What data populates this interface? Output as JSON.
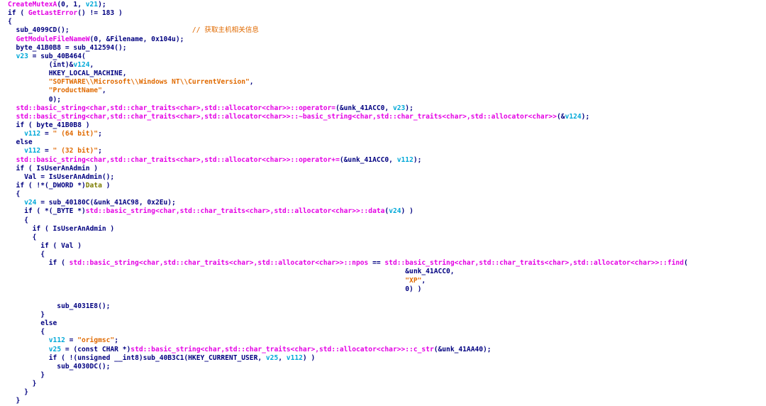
{
  "code": {
    "colors": {
      "p": "#000080",
      "f": "#e400e4",
      "v": "#00a8d8",
      "s": "#e06a00",
      "c": "#e06a00",
      "g": "#7c7c00",
      "k": "#000080"
    },
    "lines": [
      [
        [
          "f",
          "CreateMutexA"
        ],
        [
          "p",
          "(0, 1, "
        ],
        [
          "v",
          "v21"
        ],
        [
          "p",
          ");"
        ]
      ],
      [
        [
          "p",
          "if ( "
        ],
        [
          "f",
          "GetLastError"
        ],
        [
          "p",
          "() != 183 )"
        ]
      ],
      [
        [
          "p",
          "{"
        ]
      ],
      [
        [
          "p",
          "  sub_4099CD();                              "
        ],
        [
          "c",
          "// 获取主机相关信息"
        ]
      ],
      [
        [
          "p",
          "  "
        ],
        [
          "f",
          "GetModuleFileNameW"
        ],
        [
          "p",
          "(0, &Filename, 0x104u);"
        ]
      ],
      [
        [
          "p",
          "  byte_41B0B8 = sub_412594();"
        ]
      ],
      [
        [
          "p",
          "  "
        ],
        [
          "v",
          "v23"
        ],
        [
          "p",
          " = sub_40B464("
        ]
      ],
      [
        [
          "p",
          "          ("
        ],
        [
          "k",
          "int"
        ],
        [
          "p",
          ")&"
        ],
        [
          "v",
          "v124"
        ],
        [
          "p",
          ","
        ]
      ],
      [
        [
          "p",
          "          HKEY_LOCAL_MACHINE,"
        ]
      ],
      [
        [
          "p",
          "          "
        ],
        [
          "s",
          "\"SOFTWARE\\\\Microsoft\\\\Windows NT\\\\CurrentVersion\""
        ],
        [
          "p",
          ","
        ]
      ],
      [
        [
          "p",
          "          "
        ],
        [
          "s",
          "\"ProductName\""
        ],
        [
          "p",
          ","
        ]
      ],
      [
        [
          "p",
          "          0);"
        ]
      ],
      [
        [
          "p",
          "  "
        ],
        [
          "f",
          "std::basic_string<char,std::char_traits<char>,std::allocator<char>>::operator="
        ],
        [
          "p",
          "(&unk_41ACC0, "
        ],
        [
          "v",
          "v23"
        ],
        [
          "p",
          ");"
        ]
      ],
      [
        [
          "p",
          "  "
        ],
        [
          "f",
          "std::basic_string<char,std::char_traits<char>,std::allocator<char>>::~basic_string<char,std::char_traits<char>,std::allocator<char>>"
        ],
        [
          "p",
          "(&"
        ],
        [
          "v",
          "v124"
        ],
        [
          "p",
          ");"
        ]
      ],
      [
        [
          "p",
          "  if ( byte_41B0B8 )"
        ]
      ],
      [
        [
          "p",
          "    "
        ],
        [
          "v",
          "v112"
        ],
        [
          "p",
          " = "
        ],
        [
          "s",
          "\" (64 bit)\""
        ],
        [
          "p",
          ";"
        ]
      ],
      [
        [
          "p",
          "  else"
        ]
      ],
      [
        [
          "p",
          "    "
        ],
        [
          "v",
          "v112"
        ],
        [
          "p",
          " = "
        ],
        [
          "s",
          "\" (32 bit)\""
        ],
        [
          "p",
          ";"
        ]
      ],
      [
        [
          "p",
          "  "
        ],
        [
          "f",
          "std::basic_string<char,std::char_traits<char>,std::allocator<char>>::operator+="
        ],
        [
          "p",
          "(&unk_41ACC0, "
        ],
        [
          "v",
          "v112"
        ],
        [
          "p",
          ");"
        ]
      ],
      [
        [
          "p",
          "  if ( IsUserAnAdmin )"
        ]
      ],
      [
        [
          "p",
          "    Val = IsUserAnAdmin();"
        ]
      ],
      [
        [
          "p",
          "  if ( !*("
        ],
        [
          "k",
          "_DWORD"
        ],
        [
          "p",
          " *)"
        ],
        [
          "g",
          "Data"
        ],
        [
          "p",
          " )"
        ]
      ],
      [
        [
          "p",
          "  {"
        ]
      ],
      [
        [
          "p",
          "    "
        ],
        [
          "v",
          "v24"
        ],
        [
          "p",
          " = sub_40180C(&unk_41AC98, 0x2Eu);"
        ]
      ],
      [
        [
          "p",
          "    if ( *("
        ],
        [
          "k",
          "_BYTE"
        ],
        [
          "p",
          " *)"
        ],
        [
          "f",
          "std::basic_string<char,std::char_traits<char>,std::allocator<char>>::data"
        ],
        [
          "p",
          "("
        ],
        [
          "v",
          "v24"
        ],
        [
          "p",
          ") )"
        ]
      ],
      [
        [
          "p",
          "    {"
        ]
      ],
      [
        [
          "p",
          "      if ( IsUserAnAdmin )"
        ]
      ],
      [
        [
          "p",
          "      {"
        ]
      ],
      [
        [
          "p",
          "        if ( Val )"
        ]
      ],
      [
        [
          "p",
          "        {"
        ]
      ],
      [
        [
          "p",
          "          if ( "
        ],
        [
          "f",
          "std::basic_string<char,std::char_traits<char>,std::allocator<char>>::npos"
        ],
        [
          "p",
          " == "
        ],
        [
          "f",
          "std::basic_string<char,std::char_traits<char>,std::allocator<char>>::find"
        ],
        [
          "p",
          "("
        ]
      ],
      [
        [
          "p",
          "                                                                                                 &unk_41ACC0,"
        ]
      ],
      [
        [
          "p",
          "                                                                                                 "
        ],
        [
          "s",
          "\"XP\""
        ],
        [
          "p",
          ","
        ]
      ],
      [
        [
          "p",
          "                                                                                                 0) )"
        ]
      ],
      [
        [
          "p",
          ""
        ]
      ],
      [
        [
          "p",
          "            sub_4031E8();"
        ]
      ],
      [
        [
          "p",
          "        }"
        ]
      ],
      [
        [
          "p",
          "        else"
        ]
      ],
      [
        [
          "p",
          "        {"
        ]
      ],
      [
        [
          "p",
          "          "
        ],
        [
          "v",
          "v112"
        ],
        [
          "p",
          " = "
        ],
        [
          "s",
          "\"origmsc\""
        ],
        [
          "p",
          ";"
        ]
      ],
      [
        [
          "p",
          "          "
        ],
        [
          "v",
          "v25"
        ],
        [
          "p",
          " = ("
        ],
        [
          "k",
          "const CHAR"
        ],
        [
          "p",
          " *)"
        ],
        [
          "f",
          "std::basic_string<char,std::char_traits<char>,std::allocator<char>>::c_str"
        ],
        [
          "p",
          "(&unk_41AA40);"
        ]
      ],
      [
        [
          "p",
          "          if ( !("
        ],
        [
          "k",
          "unsigned __int8"
        ],
        [
          "p",
          ")sub_40B3C1(HKEY_CURRENT_USER, "
        ],
        [
          "v",
          "v25"
        ],
        [
          "p",
          ", "
        ],
        [
          "v",
          "v112"
        ],
        [
          "p",
          ") )"
        ]
      ],
      [
        [
          "p",
          "            sub_4030DC();"
        ]
      ],
      [
        [
          "p",
          "        }"
        ]
      ],
      [
        [
          "p",
          "      }"
        ]
      ],
      [
        [
          "p",
          "    }"
        ]
      ],
      [
        [
          "p",
          "  }"
        ]
      ]
    ]
  }
}
